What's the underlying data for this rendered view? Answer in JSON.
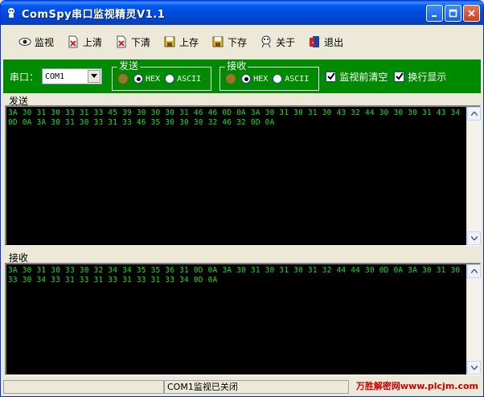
{
  "window": {
    "title": "ComSpy串口监视精灵V1.1"
  },
  "toolbar": {
    "monitor": "监视",
    "clear_top": "上清",
    "clear_bottom": "下清",
    "save_top": "上存",
    "save_bottom": "下存",
    "about": "关于",
    "exit": "退出"
  },
  "settings": {
    "port_label": "串口：",
    "port_value": "COM1",
    "send_group": {
      "title": "发送",
      "hex": "HEX",
      "ascii": "ASCII",
      "selected": "HEX"
    },
    "recv_group": {
      "title": "接收",
      "hex": "HEX",
      "ascii": "ASCII",
      "selected": "HEX"
    },
    "clear_before_monitor": {
      "label": "监视前清空",
      "checked": true
    },
    "wrap_display": {
      "label": "换行显示",
      "checked": true
    }
  },
  "send_pane": {
    "label": "发送",
    "text": "3A 30 31 30 33 31 33 45 39 30 30 30 31 46 46 0D 0A 3A 30 31 30 31 30 43 32 44 30 30 30 31 43 34 0D 0A 3A 30 31 30 33 31 33 46 35 30 30 30 32 46 32 0D 0A"
  },
  "recv_pane": {
    "label": "接收",
    "text": "3A 30 31 30 33 30 32 34 34 35 35 36 31 0D 0A 3A 30 31 30 31 30 31 32 44 44 30 0D 0A 3A 30 31 30 33 30 34 33 31 33 31 33 31 33 31 33 34 0D 0A"
  },
  "status": {
    "message": "COM1监视已关闭",
    "watermark": "万胜解密网www.plcjm.com"
  },
  "colors": {
    "settings_bg": "#008a00",
    "terminal_bg": "#000000",
    "terminal_text": "#22d822",
    "titlebar": "#0047d8"
  }
}
